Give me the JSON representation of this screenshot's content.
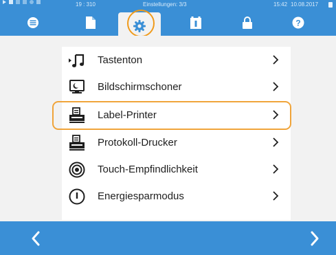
{
  "status": {
    "counter": "19 : 310",
    "title": "Einstellungen: 3/3",
    "time": "15:42",
    "date": "10.08.2017"
  },
  "tabs": [
    {
      "icon": "list-icon",
      "active": false
    },
    {
      "icon": "document-icon",
      "active": false
    },
    {
      "icon": "gear-icon",
      "active": true
    },
    {
      "icon": "info-card-icon",
      "active": false
    },
    {
      "icon": "lock-icon",
      "active": false
    },
    {
      "icon": "help-icon",
      "active": false
    }
  ],
  "menu": {
    "items": [
      {
        "label": "Tastenton",
        "icon": "music-note-icon"
      },
      {
        "label": "Bildschirmschoner",
        "icon": "screensaver-icon"
      },
      {
        "label": "Label-Printer",
        "icon": "printer-icon"
      },
      {
        "label": "Protokoll-Drucker",
        "icon": "printer-icon"
      },
      {
        "label": "Touch-Empfindlichkeit",
        "icon": "touch-target-icon"
      },
      {
        "label": "Energiesparmodus",
        "icon": "power-icon"
      }
    ],
    "highlighted_index": 2
  },
  "colors": {
    "primary": "#3a8fd6",
    "highlight": "#f0a43a",
    "text": "#1e1e1e"
  }
}
